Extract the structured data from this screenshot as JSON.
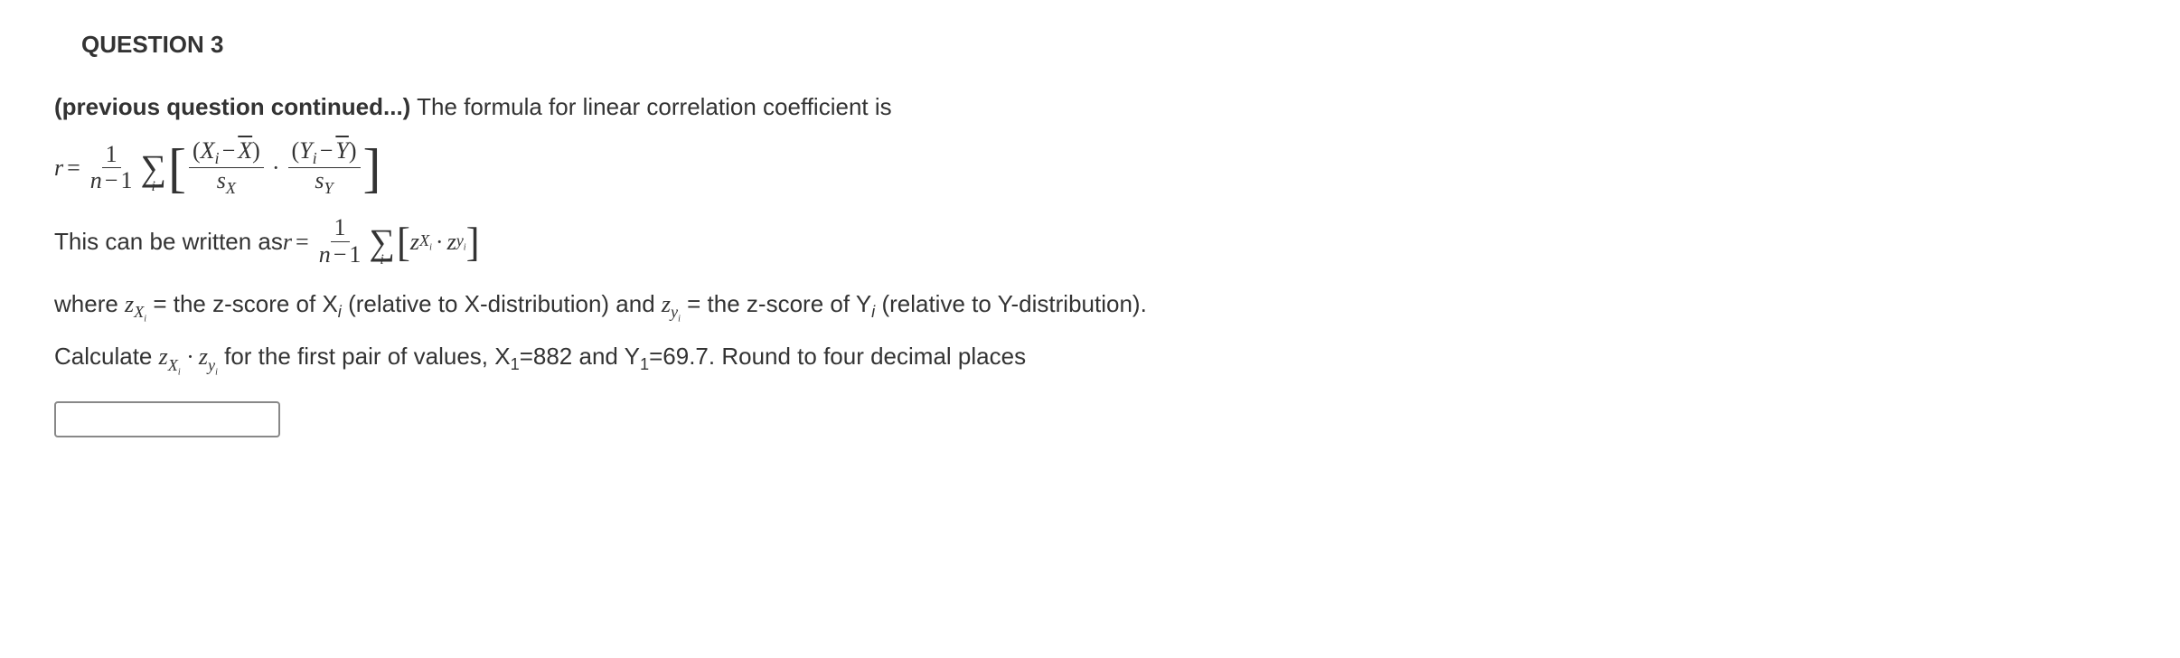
{
  "question": {
    "title": "QUESTION 3",
    "intro_bold": "(previous question continued...)",
    "intro_rest": " The formula for linear correlation coefficient is",
    "formula1": {
      "lhs": "r",
      "eq": "=",
      "frac1_num": "1",
      "frac1_den_n": "n",
      "frac1_den_minus": "−",
      "frac1_den_one": "1",
      "sigma": "∑",
      "sigma_sub": "i",
      "lbracket": "[",
      "fx_num_open": "(",
      "fx_num_X": "X",
      "fx_num_isub": "i",
      "fx_num_minus": "−",
      "fx_num_Xbar": "X",
      "fx_num_close": ")",
      "fx_den_s": "s",
      "fx_den_x": "X",
      "dot": "·",
      "fy_num_open": "(",
      "fy_num_Y": "Y",
      "fy_num_isub": "i",
      "fy_num_minus": "−",
      "fy_num_Ybar": "Y",
      "fy_num_close": ")",
      "fy_den_s": "s",
      "fy_den_y": "Y",
      "rbracket": "]"
    },
    "line2_prefix": "This can be written as  ",
    "formula2": {
      "lhs": "r",
      "eq": "=",
      "frac_num": "1",
      "frac_den_n": "n",
      "frac_den_minus": "−",
      "frac_den_one": "1",
      "sigma": "∑",
      "sigma_sub": "i",
      "lbracket": "[",
      "z1": "z",
      "z1_x": "X",
      "z1_i": "i",
      "dot": "·",
      "z2": "z",
      "z2_y": "y",
      "z2_i": "i",
      "rbracket": "]"
    },
    "where_prefix": "where ",
    "where_zx_z": "z",
    "where_zx_x": "X",
    "where_zx_i": "i",
    "where_mid1": " = the z-score of X",
    "where_mid1_i": "i",
    "where_mid2": " (relative to X-distribution) and",
    "where_zy_z": "z",
    "where_zy_y": "y",
    "where_zy_i": "i",
    "where_mid3": "= the z-score of Y",
    "where_mid3_i": "i",
    "where_mid4": " (relative to Y-distribution).",
    "calc_prefix": "Calculate ",
    "calc_zx_z": "z",
    "calc_zx_x": "X",
    "calc_zx_i": "i",
    "calc_dot": " · ",
    "calc_zy_z": "z",
    "calc_zy_y": "y",
    "calc_zy_i": "i",
    "calc_rest1": " for the first pair of values, X",
    "calc_sub1": "1",
    "calc_rest2": "=882 and Y",
    "calc_sub2": "1",
    "calc_rest3": "=69.7. Round to four decimal places"
  }
}
